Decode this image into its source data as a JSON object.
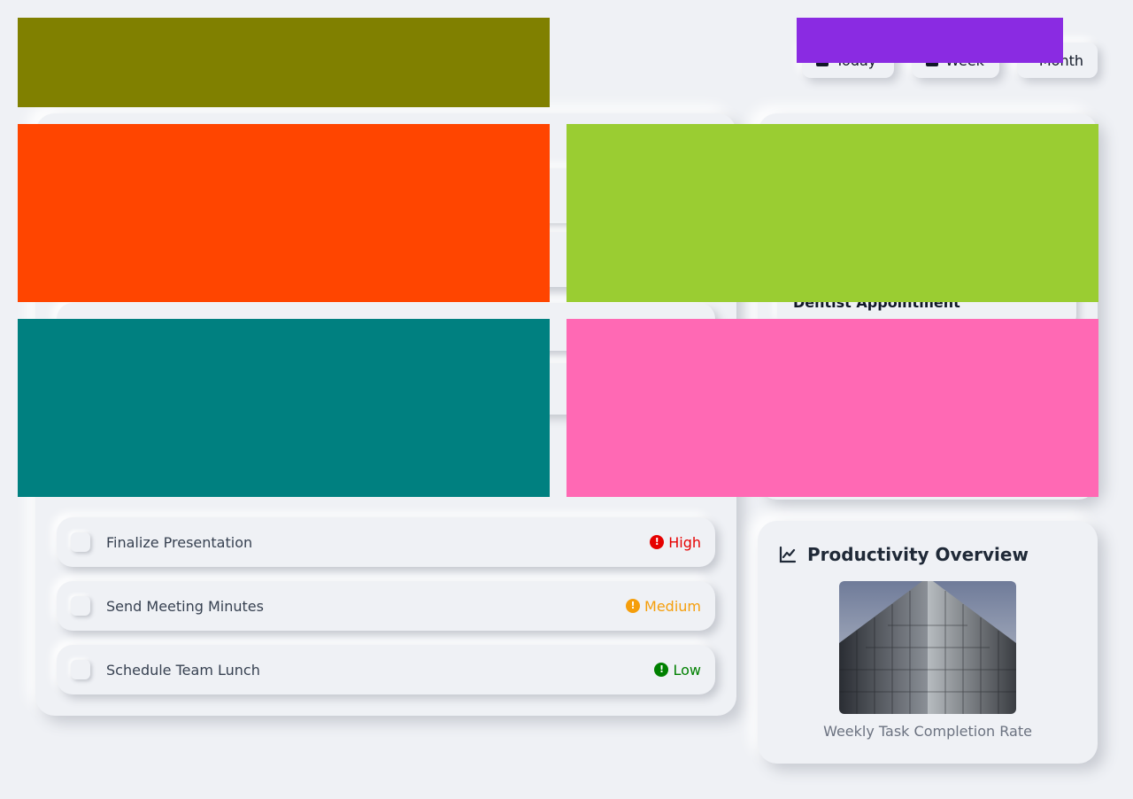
{
  "header": {
    "views": [
      {
        "label": "Today",
        "icon": "calendar-icon"
      },
      {
        "label": "Week",
        "icon": "calendar-week-icon"
      },
      {
        "label": "Month",
        "icon": "calendar-month-icon"
      }
    ]
  },
  "tasks": {
    "items": [
      {
        "title": "Finalize Presentation",
        "priority": "High",
        "color": "#e60000"
      },
      {
        "title": "Send Meeting Minutes",
        "priority": "Medium",
        "color": "#f59e0b"
      },
      {
        "title": "Schedule Team Lunch",
        "priority": "Low",
        "color": "#008000"
      }
    ]
  },
  "appointments": {
    "item_title": "Dentist Appointment"
  },
  "productivity": {
    "title": "Productivity Overview",
    "caption": "Weekly Task Completion Rate",
    "icon": "chart-line-icon"
  },
  "placeholders": {
    "colors": [
      "#808000",
      "#8a2be2",
      "#ff4500",
      "#9acd32",
      "#008080",
      "#ff69b4"
    ]
  }
}
